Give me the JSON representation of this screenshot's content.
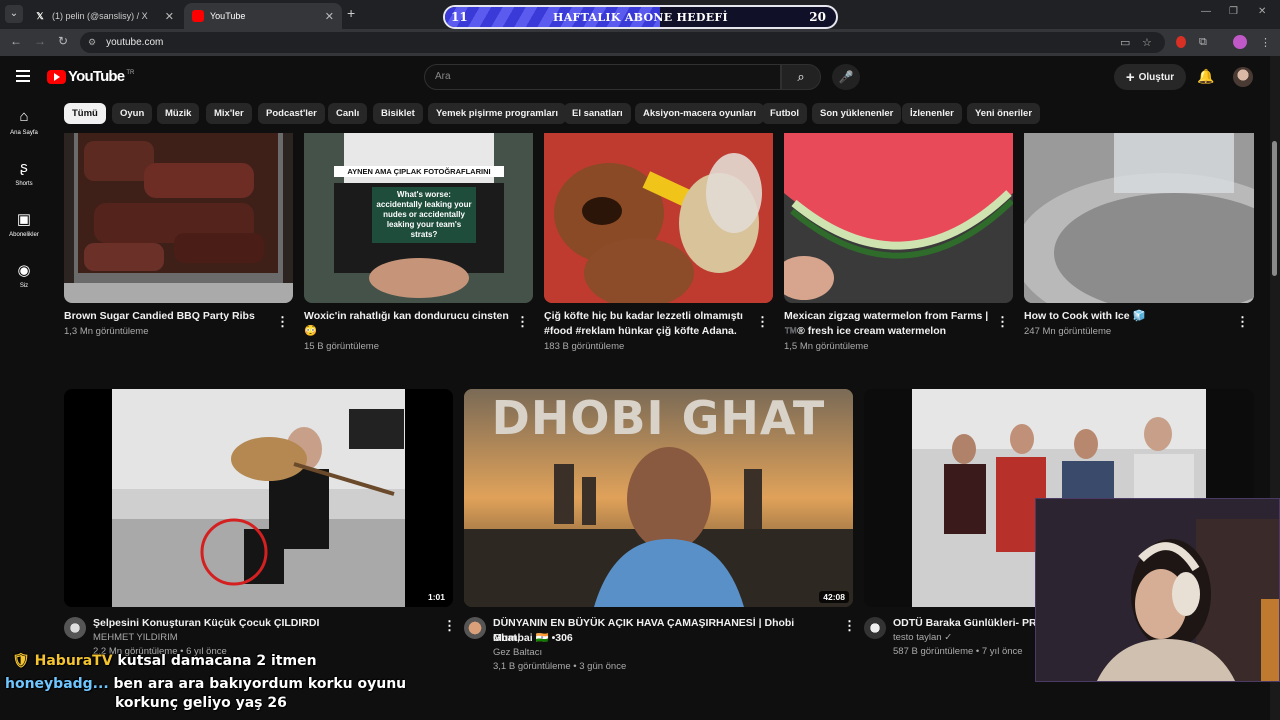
{
  "browser": {
    "tabs": [
      {
        "title": "(1) pelin (@sanslisy) / X",
        "favicon": "x-logo-icon"
      },
      {
        "title": "YouTube",
        "favicon": "youtube-icon"
      }
    ],
    "url": "youtube.com"
  },
  "overlay_goal": {
    "title": "HAFTALIK ABONE HEDEFİ",
    "current": "11",
    "target": "20",
    "progress": 0.55,
    "color": "#3a3ad8"
  },
  "header": {
    "logo": "YouTube",
    "logo_region": "TR",
    "search_placeholder": "Ara",
    "create_label": "Oluştur"
  },
  "sidebar": {
    "items": [
      {
        "label": "Ana Sayfa",
        "icon": "home-icon"
      },
      {
        "label": "Shorts",
        "icon": "shorts-icon"
      },
      {
        "label": "Abonelikler",
        "icon": "subscriptions-icon"
      },
      {
        "label": "Siz",
        "icon": "you-icon"
      }
    ]
  },
  "chips": [
    "Tümü",
    "Oyun",
    "Müzik",
    "Mix'ler",
    "Podcast'ler",
    "Canlı",
    "Bisiklet",
    "Yemek pişirme programları",
    "El sanatları",
    "Aksiyon-macera oyunları",
    "Futbol",
    "Son yüklenenler",
    "İzlenenler",
    "Yeni öneriler"
  ],
  "row1": [
    {
      "title1": "Brown Sugar Candied BBQ Party Ribs",
      "title2": "",
      "views": "1,3 Mn görüntüleme"
    },
    {
      "title1": "Woxic'in rahatlığı kan dondurucu cinsten",
      "title2": "😳",
      "views": "15 B görüntüleme",
      "thumb_text1": "AYNEN AMA ÇIPLAK FOTOĞRAFLARINI",
      "thumb_text2": "What's worse: accidentally leaking your nudes or accidentally leaking your team's strats?"
    },
    {
      "title1": "Çiğ köfte hiç bu kadar lezzetli olmamıştı",
      "title2": "#food #reklam hünkar çiğ köfte Adana.",
      "views": "183 B görüntüleme"
    },
    {
      "title1": "Mexican zigzag watermelon from Farms |",
      "title2": "™️® fresh ice cream watermelon",
      "views": "1,5 Mn görüntüleme"
    },
    {
      "title1": "How to Cook with Ice 🧊",
      "title2": "",
      "views": "247 Mn görüntüleme"
    }
  ],
  "row2": [
    {
      "title1": "Şelpesini Konuşturan Küçük Çocuk ÇILDIRDI",
      "title2": "",
      "channel": "MEHMET YILDIRIM",
      "views": "2,2 Mn görüntüleme • 6 yıl önce",
      "duration": "1:01"
    },
    {
      "title1": "DÜNYANIN EN BÜYÜK AÇIK HAVA ÇAMAŞIRHANESİ | Dhobi Ghat,",
      "title2": "Mumbai 🇮🇳 •306",
      "channel": "Gez Baltacı",
      "views": "3,1 B görüntüleme • 3 gün önce",
      "duration": "42:08",
      "thumb_text": "DHOBI GHAT"
    },
    {
      "title1": "ODTÜ Baraka Günlükleri- PR D",
      "title2": "",
      "channel": "testo taylan ✓",
      "views": "587 B görüntüleme • 7 yıl önce",
      "duration": ""
    }
  ],
  "chat": [
    {
      "user": "🛡 HaburaTV",
      "message": "kutsal damacana 2 itmen"
    },
    {
      "user": "honeybadg...",
      "message": "ben ara ara bakıyordum korku oyunu"
    },
    {
      "user": "",
      "message": "korkunç geliyo yaş 26"
    }
  ]
}
